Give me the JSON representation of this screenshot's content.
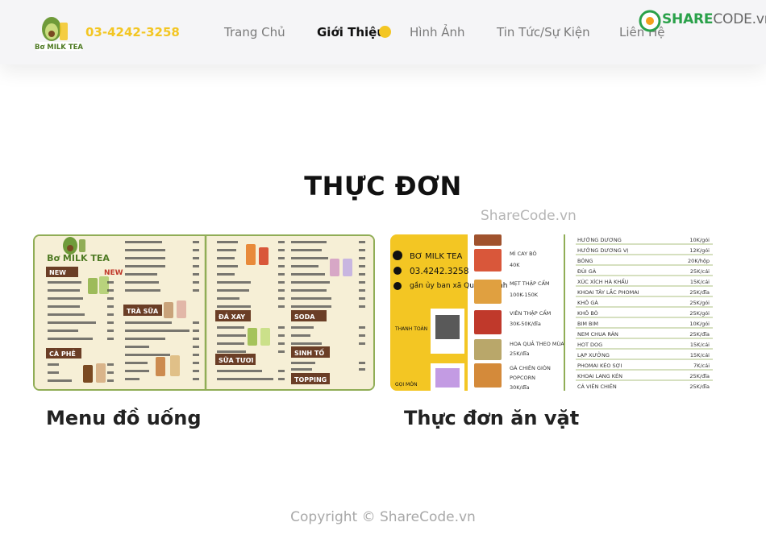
{
  "header": {
    "logo_text": "Bơ MILK TEA",
    "phone": "03-4242-3258",
    "nav": [
      {
        "label": "Trang Chủ"
      },
      {
        "label": "Giới Thiệu"
      },
      {
        "label": "Hình Ảnh"
      },
      {
        "label": "Tin Tức/Sự Kiện"
      },
      {
        "label": "Liên Hệ"
      }
    ],
    "watermark_logo": {
      "brand": "SHARE",
      "suffix": "CODE.vn"
    }
  },
  "section": {
    "title": "THỰC ĐƠN"
  },
  "watermarks": {
    "center": "ShareCode.vn",
    "footer": "Copyright © ShareCode.vn"
  },
  "cards": [
    {
      "caption": "Menu đồ uống",
      "image": {
        "logo_text": "Bơ MILK TEA",
        "sections": [
          "NEW",
          "CÀ PHÊ",
          "TRÀ SỮA",
          "ĐÁ XAY",
          "SỮA TƯƠI",
          "SODA",
          "SINH TỐ",
          "TOPPING"
        ],
        "new_badge": "NEW"
      }
    },
    {
      "caption": "Thực đơn ăn vặt",
      "image": {
        "brand": "BƠ MILK TEA",
        "phone": "03.4242.3258",
        "address": "gần ủy ban xã Quang Minh",
        "pay_label": "THANH TOÁN",
        "order_label": "GỌI MÓN",
        "middle_items": [
          {
            "name": "MÌ CAY BÒ",
            "price": "40K"
          },
          {
            "name": "MẸT THẬP CẨM",
            "price": "100K-150K"
          },
          {
            "name": "VIÊN THẬP CẨM",
            "price": "30K-50K/đĩa"
          },
          {
            "name": "HOA QUẢ THEO MÙA",
            "price": "25K/đĩa"
          },
          {
            "name": "GÀ CHIÊN GIÒN",
            "price": ""
          },
          {
            "name": "POPCORN",
            "price": "30K/đĩa"
          }
        ],
        "right_items": [
          {
            "name": "HƯỚNG DƯƠNG",
            "price": "10K/gói"
          },
          {
            "name": "HƯỚNG DƯƠNG VỊ",
            "price": "12K/gói"
          },
          {
            "name": "BÓNG",
            "price": "20K/hộp"
          },
          {
            "name": "ĐÙI GÀ",
            "price": "25K/cái"
          },
          {
            "name": "XÚC XÍCH HÀ KHẨU",
            "price": "15K/cái"
          },
          {
            "name": "KHOAI TÂY LẮC PHOMAI",
            "price": "25K/đĩa"
          },
          {
            "name": "KHÔ GÀ",
            "price": "25K/gói"
          },
          {
            "name": "KHÔ BÒ",
            "price": "25K/gói"
          },
          {
            "name": "BIM BIM",
            "price": "10K/gói"
          },
          {
            "name": "NEM CHUA RÁN",
            "price": "25K/đĩa"
          },
          {
            "name": "HOT DOG",
            "price": "15K/cái"
          },
          {
            "name": "LẠP XƯỞNG",
            "price": "15K/cái"
          },
          {
            "name": "PHOMAI KÉO SỢI",
            "price": "7K/cái"
          },
          {
            "name": "KHOAI LANG KÉN",
            "price": "25K/đĩa"
          },
          {
            "name": "CÁ VIÊN CHIÊN",
            "price": "25K/đĩa"
          }
        ]
      }
    }
  ],
  "colors": {
    "accent_yellow": "#f3c623",
    "menu_green": "#90ad56",
    "menu_brown": "#6b3e26",
    "menu_cream": "#f6efd6"
  }
}
